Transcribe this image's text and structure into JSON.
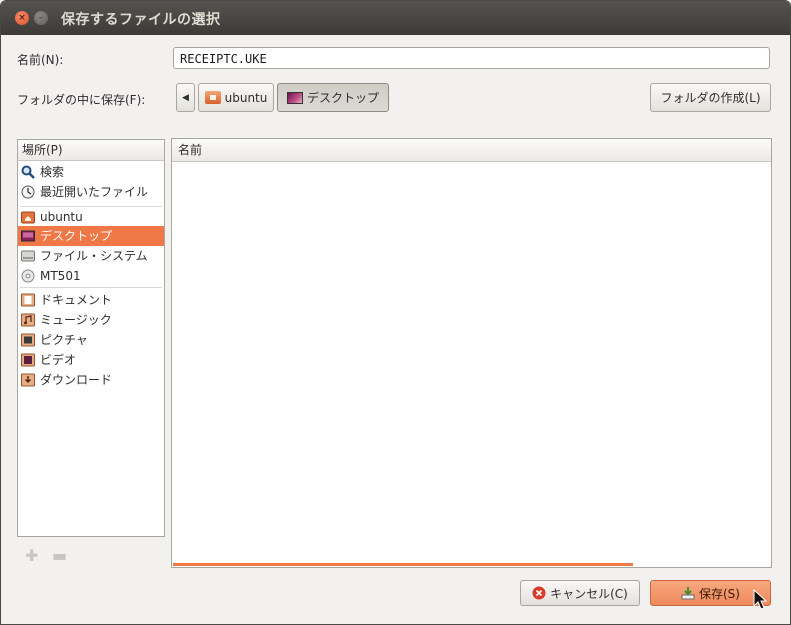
{
  "window": {
    "title": "保存するファイルの選択"
  },
  "name_field": {
    "label": "名前(N):",
    "value": "RECEIPTC.UKE"
  },
  "folder_row": {
    "label": "フォルダの中に保存(F):",
    "path": [
      {
        "label": "ubuntu",
        "icon": "home-folder-icon"
      },
      {
        "label": "デスクトップ",
        "icon": "desktop-icon"
      }
    ],
    "create_folder_label": "フォルダの作成(L)"
  },
  "places": {
    "header": "場所(P)",
    "items": [
      {
        "label": "検索",
        "icon": "search-icon"
      },
      {
        "label": "最近開いたファイル",
        "icon": "recent-icon"
      },
      {
        "label": "ubuntu",
        "icon": "home-folder-icon"
      },
      {
        "label": "デスクトップ",
        "icon": "desktop-icon",
        "selected": true
      },
      {
        "label": "ファイル・システム",
        "icon": "drive-icon"
      },
      {
        "label": "MT501",
        "icon": "disc-icon"
      },
      {
        "label": "ドキュメント",
        "icon": "documents-folder-icon"
      },
      {
        "label": "ミュージック",
        "icon": "music-folder-icon"
      },
      {
        "label": "ピクチャ",
        "icon": "pictures-folder-icon"
      },
      {
        "label": "ビデオ",
        "icon": "videos-folder-icon"
      },
      {
        "label": "ダウンロード",
        "icon": "downloads-folder-icon"
      }
    ]
  },
  "files": {
    "column_header": "名前",
    "progress": 0.77
  },
  "actions": {
    "cancel_label": "キャンセル(C)",
    "save_label": "保存(S)"
  },
  "colors": {
    "accent": "#f07746",
    "titlebar": "#3c3b37"
  }
}
